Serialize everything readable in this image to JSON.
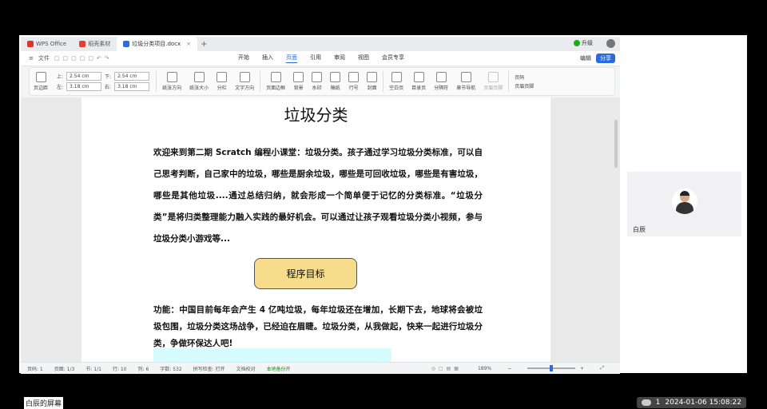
{
  "tabs": [
    {
      "label": "WPS Office",
      "color": "#d9342b"
    },
    {
      "label": "稻壳素材",
      "color": "#e2402f"
    },
    {
      "label": "垃圾分类项目.docx",
      "color": "#2a6be0"
    }
  ],
  "header": {
    "upgrade": "升级"
  },
  "menu": {
    "file": "文件",
    "items": [
      "开始",
      "插入",
      "页面",
      "引用",
      "审阅",
      "视图",
      "会员专享"
    ],
    "active": "页面",
    "edit": "编辑",
    "share": "分享"
  },
  "ribbon": {
    "page_margin": "页边距",
    "margins": {
      "top_label": "上:",
      "top": "2.54 cm",
      "bottom_label": "下:",
      "bottom": "2.54 cm",
      "left_label": "左:",
      "left": "3.18 cm",
      "right_label": "右:",
      "right": "3.18 cm"
    },
    "tools": [
      "纸张方向",
      "纸张大小",
      "分栏",
      "文字方向",
      "页面边框",
      "背景",
      "水印",
      "稿纸",
      "行号",
      "封面",
      "空白页",
      "目录页",
      "分隔符",
      "章节导航",
      "页眉页脚"
    ],
    "header_label": "页码",
    "header_footer": "页眉页脚"
  },
  "document": {
    "title": "垃圾分类",
    "intro": "欢迎来到第二期 Scratch 编程小课堂：垃圾分类。孩子通过学习垃圾分类标准，可以自己思考判断，自己家中的垃圾，哪些是厨余垃圾，哪些是可回收垃圾，哪些是有害垃圾，哪些是其他垃圾....通过总结归纳，就会形成一个简单便于记忆的分类标准。“垃圾分类”是将归类整理能力融入实践的最好机会。可以通过让孩子观看垃圾分类小视频，参与垃圾分类小游戏等...",
    "goal_button": "程序目标",
    "function_text": "功能：中国目前每年会产生 4 亿吨垃圾，每年垃圾还在增加，长期下去，地球将会被垃圾包围，垃圾分类这场战争，已经迫在眉睫。垃圾分类，从我做起，快来一起进行垃圾分类，争做环保达人吧!"
  },
  "status": {
    "page_num": "页码: 1",
    "pages": "页面: 1/3",
    "section": "节: 1/1",
    "line": "行: 10",
    "col": "列: 6",
    "words": "字数: 532",
    "spell": "拼写检查: 打开",
    "proof": "文档校对",
    "saved": "本地备份开",
    "zoom": "189%"
  },
  "video": {
    "name": "白辰"
  },
  "screen_caption": "白辰的屏幕",
  "clock": {
    "count": "1",
    "datetime": "2024-01-06 15:08:22"
  }
}
